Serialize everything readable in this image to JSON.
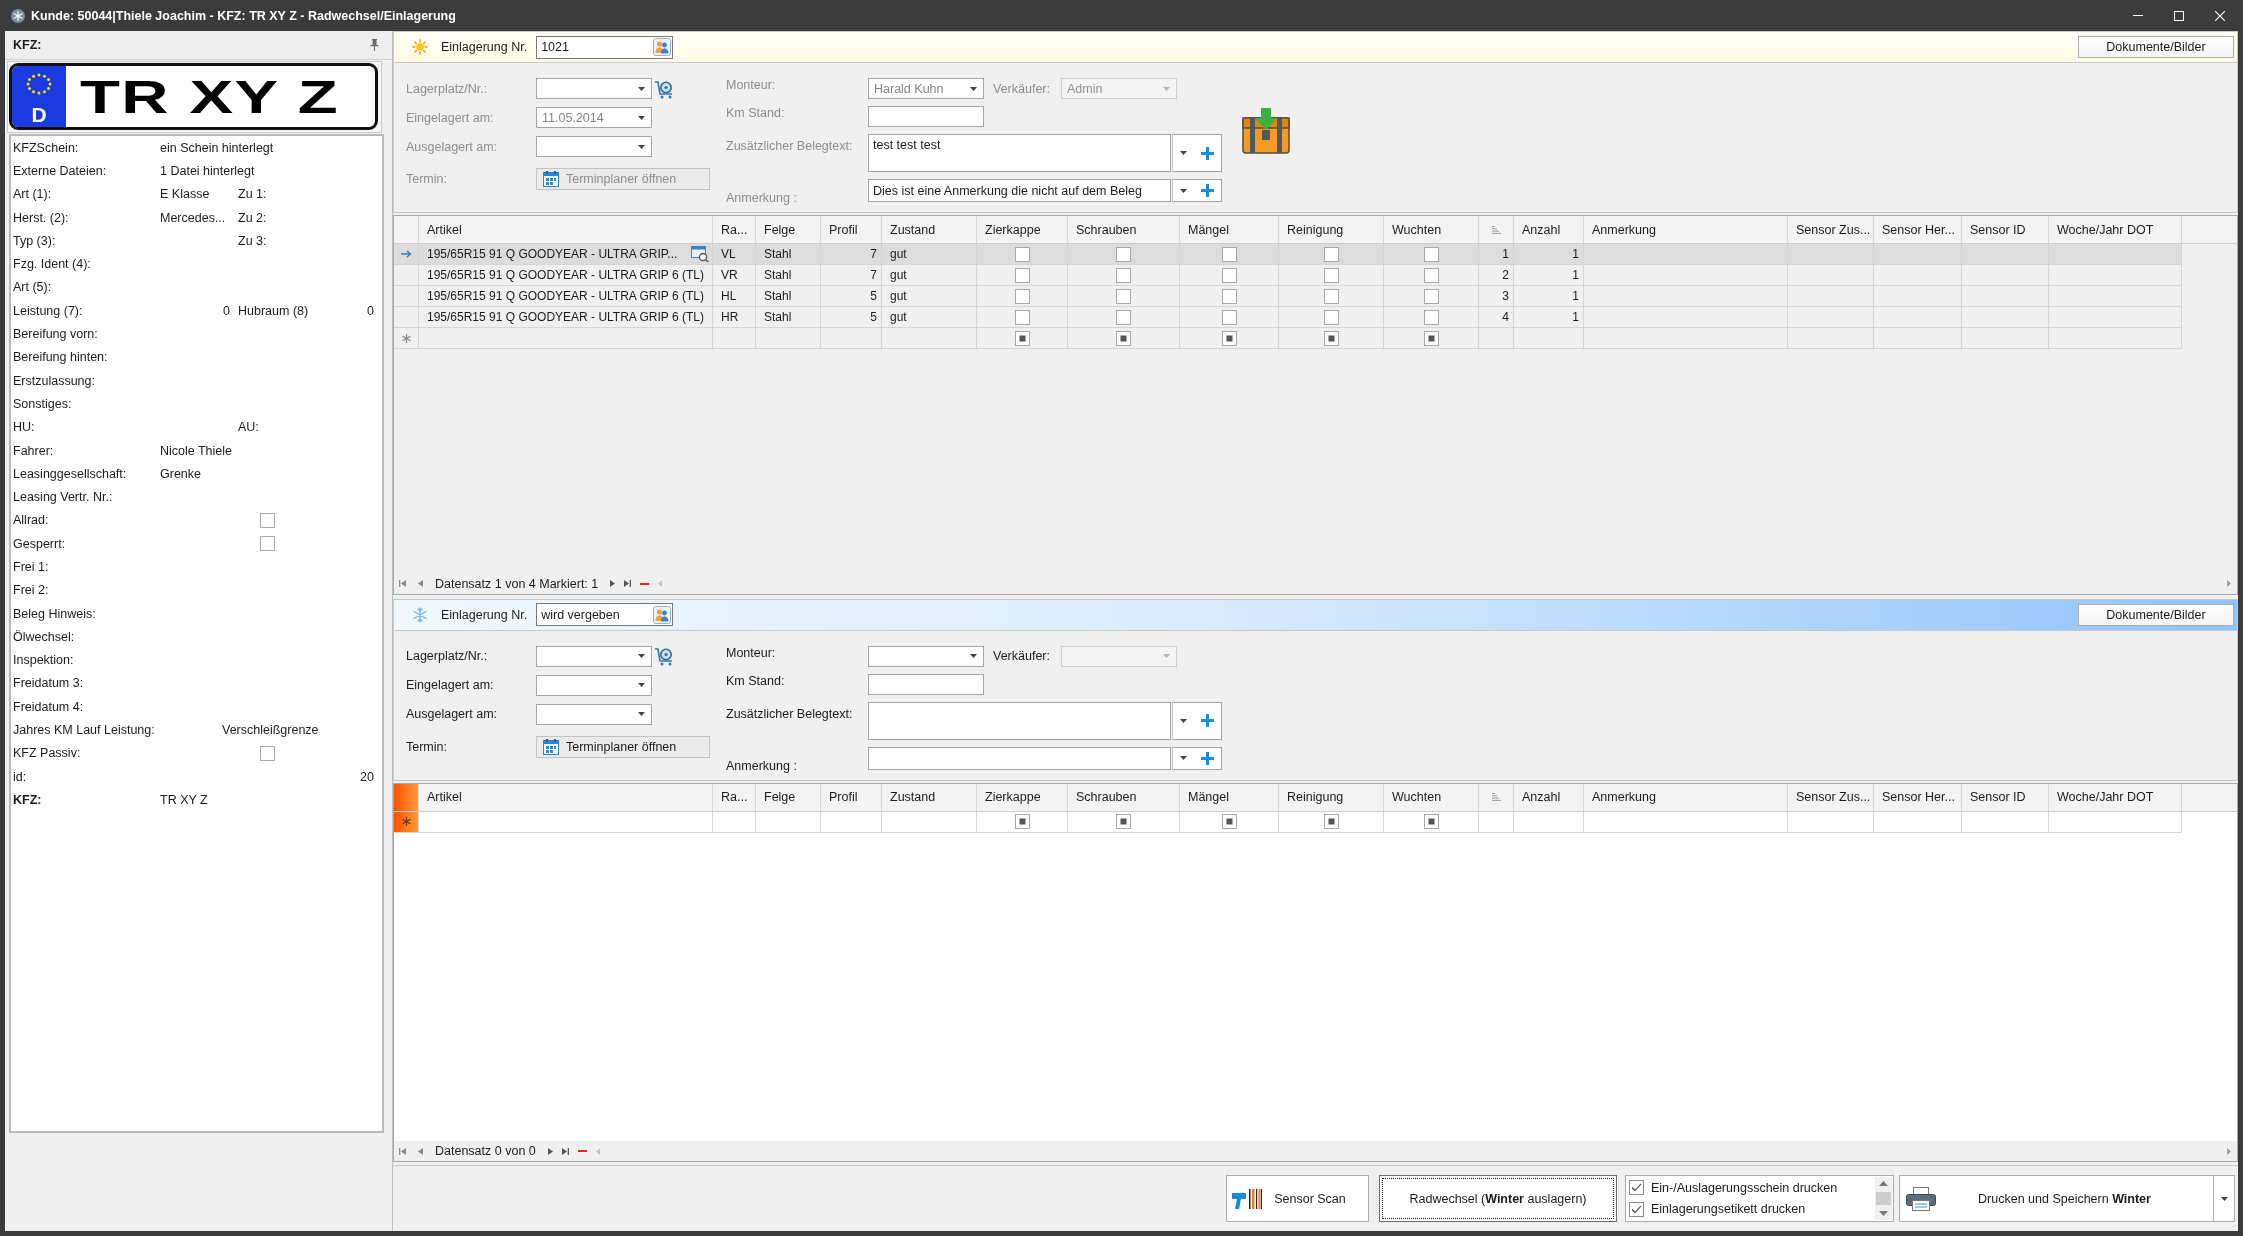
{
  "window": {
    "title": "Kunde: 50044|Thiele Joachim - KFZ: TR XY Z - Radwechsel/Einlagerung"
  },
  "vehicle_panel": {
    "title": "KFZ:",
    "plate": {
      "country": "D",
      "text": "TR XY Z"
    },
    "fields": [
      {
        "kind": "text",
        "label": "KFZSchein:",
        "value": "ein Schein hinterlegt"
      },
      {
        "kind": "text",
        "label": "Externe Dateien:",
        "value": "1 Datei hinterlegt"
      },
      {
        "kind": "pair",
        "label": "Art (1):",
        "value": "E Klasse",
        "label2": "Zu 1:"
      },
      {
        "kind": "pair",
        "label": "Herst. (2):",
        "value": "Mercedes...",
        "label2": "Zu 2:"
      },
      {
        "kind": "pair",
        "label": "Typ (3):",
        "label2": "Zu 3:"
      },
      {
        "kind": "text",
        "label": "Fzg. Ident (4):"
      },
      {
        "kind": "text",
        "label": "Art (5):"
      },
      {
        "kind": "numbers",
        "label": "Leistung (7):",
        "value": "0",
        "label2": "Hubraum (8)",
        "value2": "0"
      },
      {
        "kind": "text",
        "label": "Bereifung vorn:"
      },
      {
        "kind": "text",
        "label": "Bereifung hinten:"
      },
      {
        "kind": "text",
        "label": "Erstzulassung:"
      },
      {
        "kind": "text",
        "label": "Sonstiges:"
      },
      {
        "kind": "pair",
        "label": "HU:",
        "label2": "AU:"
      },
      {
        "kind": "text",
        "label": "Fahrer:",
        "value": "Nicole Thiele"
      },
      {
        "kind": "text",
        "label": "Leasinggesellschaft:",
        "value": "Grenke"
      },
      {
        "kind": "text",
        "label": "Leasing Vertr. Nr.:"
      },
      {
        "kind": "check",
        "label": "Allrad:",
        "checked": false
      },
      {
        "kind": "check",
        "label": "Gesperrt:",
        "checked": false
      },
      {
        "kind": "text",
        "label": "Frei 1:"
      },
      {
        "kind": "text",
        "label": "Frei 2:"
      },
      {
        "kind": "text",
        "label": "Beleg Hinweis:"
      },
      {
        "kind": "text",
        "label": "Ölwechsel:"
      },
      {
        "kind": "text",
        "label": "Inspektion:"
      },
      {
        "kind": "text",
        "label": "Freidatum 3:"
      },
      {
        "kind": "text",
        "label": "Freidatum 4:"
      },
      {
        "kind": "offset",
        "label": "Jahres KM Lauf Leistung:",
        "value": "Verschleißgrenze"
      },
      {
        "kind": "check",
        "label": "KFZ Passiv:",
        "checked": false
      },
      {
        "kind": "number",
        "label": "id:",
        "value": "20"
      },
      {
        "kind": "bold",
        "label": "KFZ:",
        "value": "TR XY Z"
      }
    ]
  },
  "sections": [
    {
      "kind": "summer",
      "disabled": true,
      "stored": true,
      "header": {
        "label": "Einlagerung Nr.",
        "number": "1021",
        "documents_button": "Dokumente/Bilder"
      },
      "form": {
        "storage_place": {
          "label": "Lagerplatz/Nr.:"
        },
        "stored_on": {
          "label": "Eingelagert am:",
          "value": "11.05.2014"
        },
        "removed_on": {
          "label": "Ausgelagert am:"
        },
        "appointment": {
          "label": "Termin:",
          "button": "Terminplaner öffnen"
        },
        "mechanic": {
          "label": "Monteur:",
          "value": "Harald Kuhn"
        },
        "seller": {
          "label": "Verkäufer:",
          "value": "Admin",
          "disabled": true
        },
        "mileage": {
          "label": "Km Stand:"
        },
        "receipt_text": {
          "label": "Zusätzlicher Belegtext:",
          "value": "test test test"
        },
        "note": {
          "label": "Anmerkung :",
          "value": "Dies ist eine Anmerkung die nicht auf dem Beleg"
        }
      },
      "grid": {
        "focused": false,
        "columns": [
          {
            "label": "Artikel",
            "kind": "article"
          },
          {
            "label": "Ra...",
            "kind": "text"
          },
          {
            "label": "Felge",
            "kind": "text"
          },
          {
            "label": "Profil",
            "kind": "number"
          },
          {
            "label": "Zustand",
            "kind": "text"
          },
          {
            "label": "Zierkappe",
            "kind": "check"
          },
          {
            "label": "Schrauben",
            "kind": "check"
          },
          {
            "label": "Mängel",
            "kind": "check"
          },
          {
            "label": "Reinigung",
            "kind": "check"
          },
          {
            "label": "Wuchten",
            "kind": "check"
          },
          {
            "kind": "sort"
          },
          {
            "label": "Anzahl",
            "kind": "number"
          },
          {
            "label": "Anmerkung",
            "kind": "text"
          },
          {
            "label": "Sensor Zus...",
            "kind": "text"
          },
          {
            "label": "Sensor Her...",
            "kind": "text"
          },
          {
            "label": "Sensor ID",
            "kind": "text"
          },
          {
            "label": "Woche/Jahr DOT",
            "kind": "text"
          }
        ],
        "rows": [
          {
            "selected": true,
            "cells": [
              "195/65R15 91 Q GOODYEAR - ULTRA GRIP...",
              "VL",
              "Stahl",
              "7",
              "gut",
              false,
              false,
              false,
              false,
              false,
              "1",
              "1"
            ]
          },
          {
            "selected": false,
            "cells": [
              "195/65R15 91 Q GOODYEAR - ULTRA GRIP 6 (TL)",
              "VR",
              "Stahl",
              "7",
              "gut",
              false,
              false,
              false,
              false,
              false,
              "2",
              "1"
            ]
          },
          {
            "selected": false,
            "cells": [
              "195/65R15 91 Q GOODYEAR - ULTRA GRIP 6 (TL)",
              "HL",
              "Stahl",
              "5",
              "gut",
              false,
              false,
              false,
              false,
              false,
              "3",
              "1"
            ]
          },
          {
            "selected": false,
            "cells": [
              "195/65R15 91 Q GOODYEAR - ULTRA GRIP 6 (TL)",
              "HR",
              "Stahl",
              "5",
              "gut",
              false,
              false,
              false,
              false,
              false,
              "4",
              "1"
            ]
          }
        ],
        "new_row": true,
        "navigator": "Datensatz 1 von 4 Markiert: 1"
      }
    },
    {
      "kind": "winter",
      "disabled": false,
      "stored": false,
      "header": {
        "label": "Einlagerung Nr.",
        "number": "wird vergeben",
        "documents_button": "Dokumente/Bilder"
      },
      "form": {
        "storage_place": {
          "label": "Lagerplatz/Nr.:"
        },
        "stored_on": {
          "label": "Eingelagert am:"
        },
        "removed_on": {
          "label": "Ausgelagert am:"
        },
        "appointment": {
          "label": "Termin:",
          "button": "Terminplaner öffnen"
        },
        "mechanic": {
          "label": "Monteur:"
        },
        "seller": {
          "label": "Verkäufer:",
          "disabled": true
        },
        "mileage": {
          "label": "Km Stand:"
        },
        "receipt_text": {
          "label": "Zusätzlicher Belegtext:"
        },
        "note": {
          "label": "Anmerkung :"
        }
      },
      "grid": {
        "focused": true,
        "columns": [
          {
            "label": "Artikel",
            "kind": "article"
          },
          {
            "label": "Ra...",
            "kind": "text"
          },
          {
            "label": "Felge",
            "kind": "text"
          },
          {
            "label": "Profil",
            "kind": "number"
          },
          {
            "label": "Zustand",
            "kind": "text"
          },
          {
            "label": "Zierkappe",
            "kind": "check"
          },
          {
            "label": "Schrauben",
            "kind": "check"
          },
          {
            "label": "Mängel",
            "kind": "check"
          },
          {
            "label": "Reinigung",
            "kind": "check"
          },
          {
            "label": "Wuchten",
            "kind": "check"
          },
          {
            "kind": "sort"
          },
          {
            "label": "Anzahl",
            "kind": "number"
          },
          {
            "label": "Anmerkung",
            "kind": "text"
          },
          {
            "label": "Sensor Zus...",
            "kind": "text"
          },
          {
            "label": "Sensor Her...",
            "kind": "text"
          },
          {
            "label": "Sensor ID",
            "kind": "text"
          },
          {
            "label": "Woche/Jahr DOT",
            "kind": "text"
          }
        ],
        "new_row": true,
        "navigator": "Datensatz 0 von 0"
      }
    }
  ],
  "actions": {
    "sensor_button": {
      "label": "Sensor Scan",
      "focused": false
    },
    "change_button": {
      "label": "Radwechsel (**Winter** auslagern)",
      "focused": true
    },
    "print_options": [
      {
        "label": "Ein-/Auslagerungsschein drucken",
        "checked": true
      },
      {
        "label": "Einlagerungsetikett drucken",
        "checked": true
      }
    ],
    "print_button": {
      "label": "Drucken und Speichern **Winter**",
      "focused": false
    }
  }
}
